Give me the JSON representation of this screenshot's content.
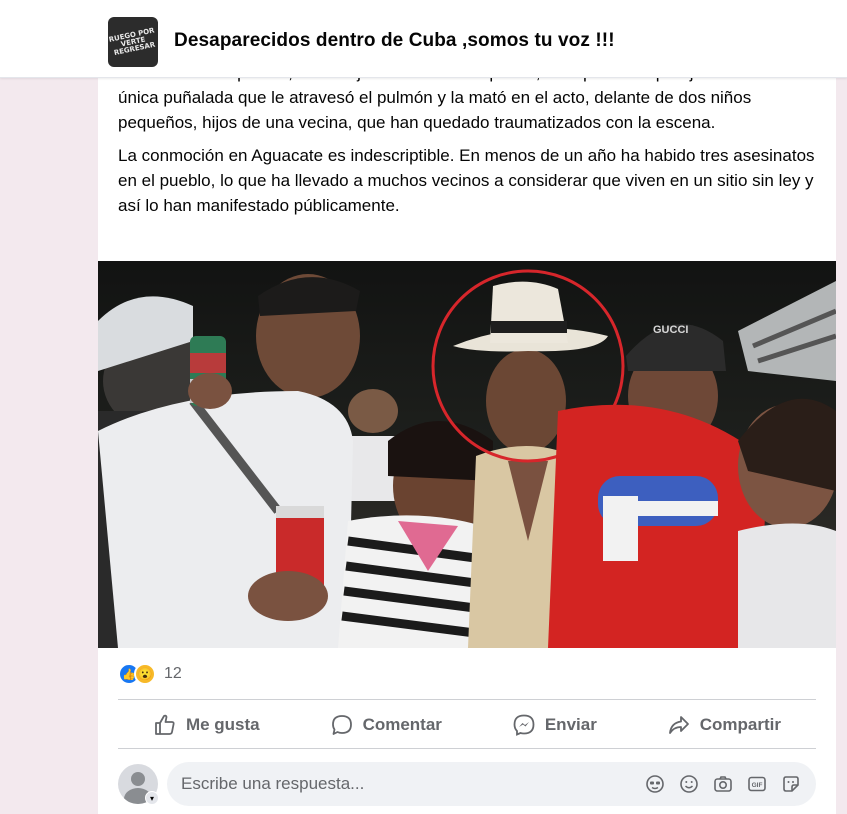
{
  "group": {
    "name": "Desaparecidos dentro de Cuba ,somos tu voz !!!",
    "avatar_text": "RUEGO POR\nVERTE\nREGRESAR"
  },
  "post": {
    "paragraph_1": "asesinato en el pueblo, el de la joven Ananni Céspedes, a la que su ex pareja le asestó una única puñalada que le atravesó el pulmón y la mató en el acto, delante de dos niños pequeños, hijos de una vecina, que han quedado traumatizados con la escena.",
    "paragraph_2": "La conmoción en Aguacate es indescriptible. En menos de un año ha habido tres asesinatos en el pueblo, lo que ha llevado a muchos vecinos a considerar que viven en un sitio sin ley y así lo han manifestado públicamente."
  },
  "photo": {
    "cap_text": "GUCCI"
  },
  "reactions": {
    "icons": [
      "like-icon",
      "wow-icon"
    ],
    "count": "12"
  },
  "actions": {
    "like": "Me gusta",
    "comment": "Comentar",
    "send": "Enviar",
    "share": "Compartir"
  },
  "comment_box": {
    "placeholder": "Escribe una respuesta...",
    "tools": [
      "avatar-sticker-icon",
      "emoji-icon",
      "camera-icon",
      "gif-icon",
      "sticker-icon"
    ]
  },
  "colors": {
    "accent": "#1877f2",
    "muted_text": "#65676b",
    "page_bg": "#f3e9ee"
  }
}
